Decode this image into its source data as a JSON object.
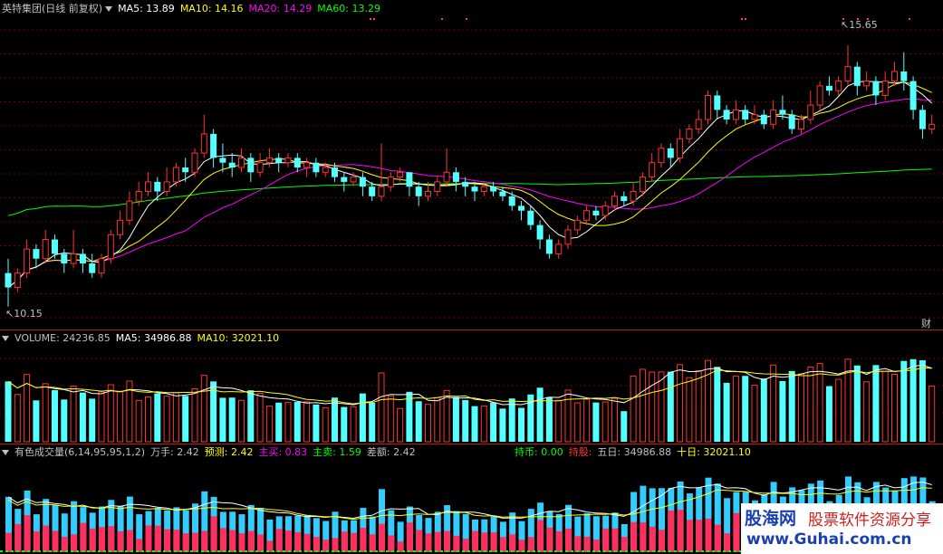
{
  "price_panel": {
    "title": "英特集团(日线 前复权)",
    "ma5_label": "MA5: 13.89",
    "ma10_label": "MA10: 14.16",
    "ma20_label": "MA20: 14.29",
    "ma60_label": "MA60: 13.29",
    "high_marker": "15.65",
    "low_marker": "10.15",
    "fin_tag": "财",
    "colors": {
      "ma5": "#ffffff",
      "ma10": "#ffff00",
      "ma20": "#ff00ff",
      "ma60": "#00ff00",
      "up": "#ff3232",
      "down": "#54ffff"
    }
  },
  "volume_panel": {
    "volume_label": "VOLUME: 24236.85",
    "ma5_label": "MA5: 34986.88",
    "ma10_label": "MA10: 32021.10"
  },
  "indicator_panel": {
    "name": "有色成交量(6,14,95,95,1,2)",
    "wanshou": "万手: 2.42",
    "yuce": "预测: 2.42",
    "zhumai": "主买: 0.83",
    "zhumai2": "主卖: 1.59",
    "chae": "差额: 2.42",
    "chibi": "持币: 0.00",
    "chigu": "持股:",
    "wuri": "五日: 34986.88",
    "shiri": "十日: 32021.10"
  },
  "watermark": {
    "logo": "股海网",
    "title": "股票软件资源分享",
    "url": "www.Guhai.com.cn"
  },
  "chart_data": {
    "type": "candlestick",
    "title": "英特集团(日线 前复权)",
    "y_range": [
      10.15,
      15.65
    ],
    "moving_averages": {
      "MA5": 13.89,
      "MA10": 14.16,
      "MA20": 14.29,
      "MA60": 13.29
    },
    "volume": {
      "last": 24236.85,
      "MA5": 34986.88,
      "MA10": 32021.1
    },
    "candles": [
      [
        10.9,
        10.6,
        11.2,
        10.2
      ],
      [
        10.6,
        10.9,
        11.0,
        10.5
      ],
      [
        10.9,
        11.4,
        11.6,
        10.8
      ],
      [
        11.4,
        11.2,
        11.5,
        11.0
      ],
      [
        11.2,
        11.6,
        11.8,
        11.1
      ],
      [
        11.6,
        11.3,
        11.7,
        11.2
      ],
      [
        11.3,
        11.1,
        11.4,
        10.9
      ],
      [
        11.1,
        11.3,
        11.8,
        11.0
      ],
      [
        11.3,
        11.1,
        11.4,
        10.9
      ],
      [
        11.1,
        10.9,
        11.3,
        10.8
      ],
      [
        10.9,
        11.2,
        11.3,
        10.8
      ],
      [
        11.2,
        11.7,
        11.8,
        11.1
      ],
      [
        11.7,
        12.0,
        12.2,
        11.6
      ],
      [
        12.0,
        12.4,
        12.6,
        11.9
      ],
      [
        12.4,
        12.6,
        12.8,
        12.3
      ],
      [
        12.6,
        12.8,
        13.0,
        12.5
      ],
      [
        12.8,
        12.6,
        12.9,
        12.4
      ],
      [
        12.6,
        12.8,
        13.1,
        12.5
      ],
      [
        12.8,
        13.1,
        13.2,
        12.7
      ],
      [
        13.1,
        13.0,
        13.3,
        12.8
      ],
      [
        13.0,
        13.4,
        13.5,
        12.9
      ],
      [
        13.4,
        13.8,
        14.2,
        13.3
      ],
      [
        13.8,
        13.3,
        13.9,
        13.1
      ],
      [
        13.3,
        13.2,
        13.6,
        13.0
      ],
      [
        13.2,
        13.1,
        13.4,
        12.9
      ],
      [
        13.1,
        13.3,
        13.5,
        13.0
      ],
      [
        13.3,
        13.0,
        13.4,
        12.8
      ],
      [
        13.0,
        13.2,
        13.4,
        12.9
      ],
      [
        13.2,
        13.3,
        13.5,
        13.1
      ],
      [
        13.3,
        13.2,
        13.4,
        13.0
      ],
      [
        13.2,
        13.3,
        13.4,
        13.1
      ],
      [
        13.3,
        13.1,
        13.4,
        13.0
      ],
      [
        13.1,
        13.2,
        13.3,
        12.9
      ],
      [
        13.2,
        13.0,
        13.3,
        12.9
      ],
      [
        13.0,
        13.1,
        13.2,
        12.9
      ],
      [
        13.1,
        12.9,
        13.2,
        12.8
      ],
      [
        12.9,
        12.8,
        13.0,
        12.6
      ],
      [
        12.8,
        12.9,
        13.0,
        12.7
      ],
      [
        12.9,
        12.7,
        13.0,
        12.5
      ],
      [
        12.7,
        12.5,
        12.8,
        12.4
      ],
      [
        12.5,
        12.7,
        13.6,
        12.4
      ],
      [
        12.7,
        12.9,
        13.0,
        12.6
      ],
      [
        12.9,
        13.0,
        13.1,
        12.8
      ],
      [
        13.0,
        12.7,
        13.0,
        12.5
      ],
      [
        12.7,
        12.5,
        12.8,
        12.3
      ],
      [
        12.5,
        12.6,
        12.8,
        12.4
      ],
      [
        12.6,
        12.8,
        12.9,
        12.5
      ],
      [
        12.8,
        13.0,
        13.5,
        12.7
      ],
      [
        13.0,
        12.8,
        13.1,
        12.6
      ],
      [
        12.8,
        12.7,
        12.9,
        12.5
      ],
      [
        12.7,
        12.6,
        12.8,
        12.4
      ],
      [
        12.6,
        12.7,
        12.8,
        12.5
      ],
      [
        12.7,
        12.6,
        12.8,
        12.5
      ],
      [
        12.6,
        12.5,
        12.7,
        12.4
      ],
      [
        12.5,
        12.3,
        12.6,
        12.2
      ],
      [
        12.3,
        12.2,
        12.4,
        12.0
      ],
      [
        12.2,
        11.9,
        12.3,
        11.8
      ],
      [
        11.9,
        11.6,
        12.0,
        11.4
      ],
      [
        11.6,
        11.3,
        11.7,
        11.2
      ],
      [
        11.3,
        11.5,
        11.6,
        11.2
      ],
      [
        11.5,
        11.8,
        11.9,
        11.4
      ],
      [
        11.8,
        12.0,
        12.1,
        11.7
      ],
      [
        12.0,
        12.2,
        12.3,
        11.9
      ],
      [
        12.2,
        12.1,
        12.3,
        12.0
      ],
      [
        12.1,
        12.3,
        12.4,
        12.0
      ],
      [
        12.3,
        12.5,
        12.6,
        12.2
      ],
      [
        12.5,
        12.4,
        12.6,
        12.3
      ],
      [
        12.4,
        12.6,
        12.8,
        12.3
      ],
      [
        12.6,
        12.9,
        13.0,
        12.5
      ],
      [
        12.9,
        13.2,
        13.4,
        12.8
      ],
      [
        13.2,
        13.5,
        13.6,
        13.1
      ],
      [
        13.5,
        13.3,
        13.6,
        13.1
      ],
      [
        13.3,
        13.7,
        13.9,
        13.2
      ],
      [
        13.7,
        13.9,
        14.0,
        13.6
      ],
      [
        13.9,
        14.1,
        14.3,
        13.8
      ],
      [
        14.1,
        14.6,
        14.7,
        14.0
      ],
      [
        14.6,
        14.3,
        14.7,
        14.1
      ],
      [
        14.3,
        14.1,
        14.4,
        14.0
      ],
      [
        14.1,
        14.3,
        14.5,
        14.0
      ],
      [
        14.3,
        14.1,
        14.4,
        14.0
      ],
      [
        14.1,
        14.2,
        14.4,
        14.0
      ],
      [
        14.2,
        14.0,
        14.3,
        13.9
      ],
      [
        14.0,
        14.3,
        14.5,
        13.9
      ],
      [
        14.3,
        14.2,
        14.6,
        14.1
      ],
      [
        14.2,
        13.9,
        14.3,
        13.8
      ],
      [
        13.9,
        14.1,
        14.2,
        13.8
      ],
      [
        14.1,
        14.4,
        14.7,
        14.0
      ],
      [
        14.4,
        14.8,
        14.9,
        14.3
      ],
      [
        14.8,
        14.7,
        15.0,
        14.6
      ],
      [
        14.7,
        14.9,
        15.0,
        14.6
      ],
      [
        14.9,
        15.2,
        15.65,
        14.8
      ],
      [
        15.2,
        14.8,
        15.3,
        14.6
      ],
      [
        14.8,
        14.9,
        15.1,
        14.7
      ],
      [
        14.9,
        14.6,
        15.0,
        14.4
      ],
      [
        14.6,
        14.9,
        15.1,
        14.5
      ],
      [
        14.9,
        15.1,
        15.3,
        14.8
      ],
      [
        15.1,
        14.9,
        15.5,
        14.7
      ],
      [
        14.9,
        14.3,
        15.0,
        14.1
      ],
      [
        14.3,
        13.9,
        14.4,
        13.7
      ],
      [
        13.9,
        14.0,
        14.2,
        13.8
      ]
    ]
  }
}
